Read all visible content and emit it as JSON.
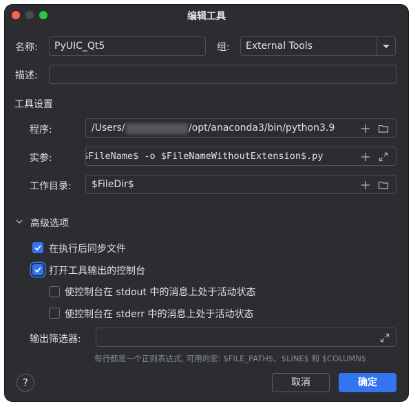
{
  "window": {
    "title": "编辑工具"
  },
  "form": {
    "name_label": "名称:",
    "name_value": "PyUIC_Qt5",
    "group_label": "组:",
    "group_value": "External Tools",
    "desc_label": "描述:",
    "desc_value": ""
  },
  "tool_settings": {
    "header": "工具设置",
    "program_label": "程序:",
    "program_prefix": "/Users/",
    "program_suffix": "/opt/anaconda3/bin/python3.9",
    "args_label": "实参:",
    "args_value": "$FileName$ -o $FileNameWithoutExtension$.py",
    "workdir_label": "工作目录:",
    "workdir_value": "$FileDir$"
  },
  "advanced": {
    "header": "高级选项",
    "sync_files_label": "在执行后同步文件",
    "sync_files_checked": true,
    "open_console_label": "打开工具输出的控制台",
    "open_console_checked": true,
    "stdout_active_label": "使控制台在 stdout 中的消息上处于活动状态",
    "stdout_active_checked": false,
    "stderr_active_label": "使控制台在 stderr 中的消息上处于活动状态",
    "stderr_active_checked": false,
    "output_filter_label": "输出筛选器:",
    "output_filter_value": "",
    "output_filter_hint": "每行都是一个正则表达式, 可用的宏: $FILE_PATH$、$LINE$ 和 $COLUMN$"
  },
  "buttons": {
    "help": "?",
    "cancel": "取消",
    "ok": "确定"
  },
  "icons": {
    "add": "plus-icon",
    "browse": "folder-icon",
    "expand": "expand-icon",
    "dropdown": "chevron-down-icon",
    "section": "chevron-down-icon",
    "check": "check-icon"
  },
  "colors": {
    "background": "#2b2d30",
    "accent": "#3574f0",
    "text": "#dfe1e5",
    "hint": "#868a91",
    "border": "#4e5157"
  }
}
